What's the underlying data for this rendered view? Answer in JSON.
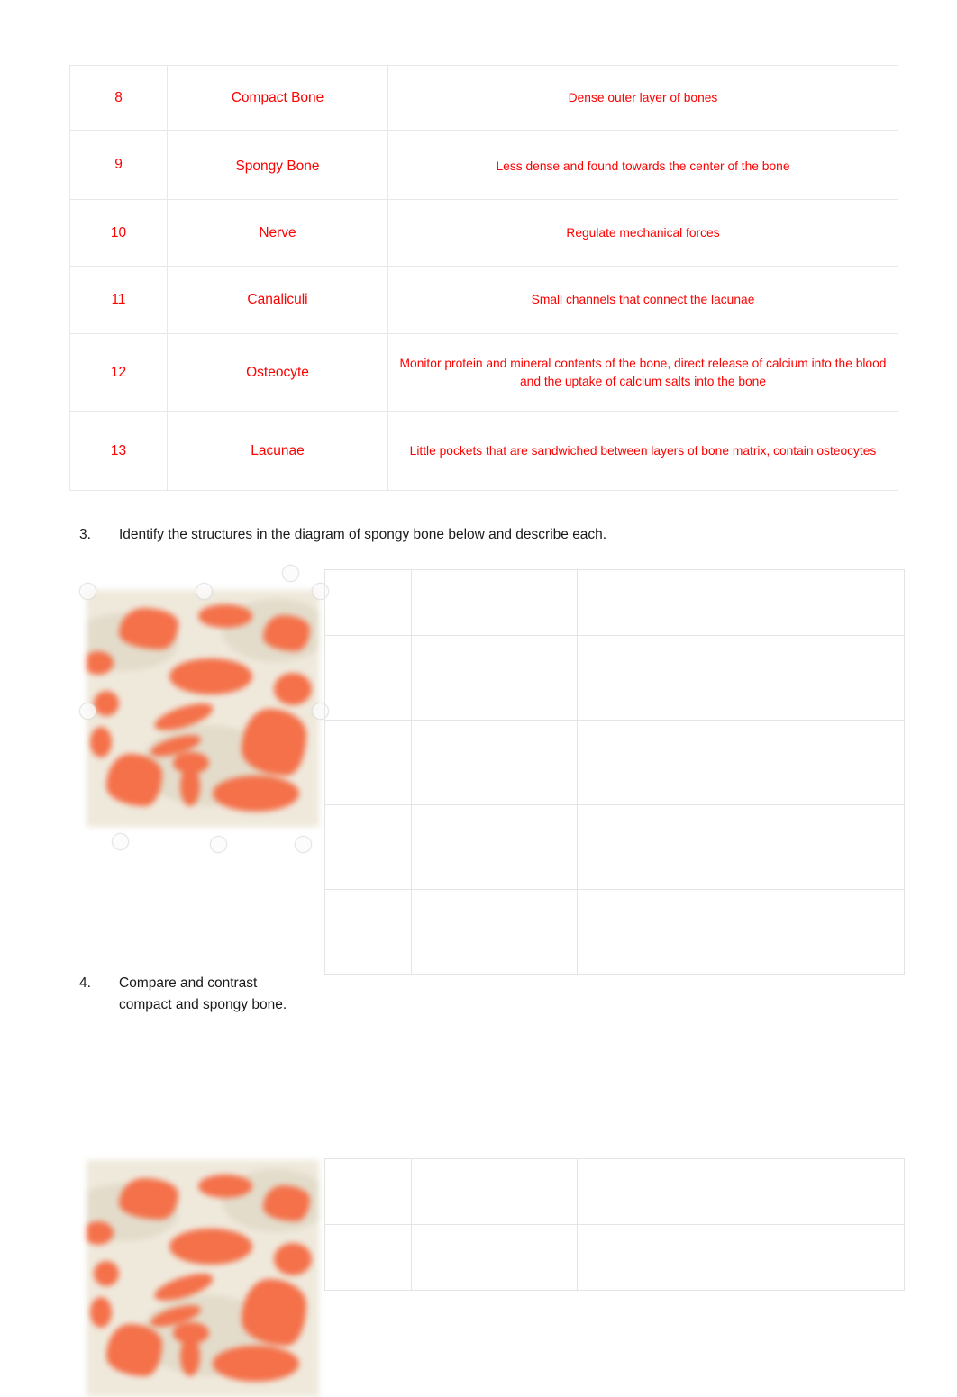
{
  "document": {
    "page_background": "#ffffff",
    "answer_text_color": "#ff0000",
    "body_text_color": "#1a1a1a"
  },
  "terms_table": {
    "rows": [
      {
        "number": "8",
        "term": "Compact Bone",
        "description": "Dense outer layer of bones"
      },
      {
        "number": "9",
        "term": "Spongy Bone",
        "description": "Less dense and found towards the center of the bone"
      },
      {
        "number": "10",
        "term": "Nerve",
        "description": "Regulate mechanical forces"
      },
      {
        "number": "11",
        "term": "Canaliculi",
        "description": "Small channels that connect the lacunae"
      },
      {
        "number": "12",
        "term": "Osteocyte",
        "description": "Monitor protein and mineral contents of the bone, direct release of calcium into the blood and the uptake of calcium salts into the bone"
      },
      {
        "number": "13",
        "term": "Lacunae",
        "description": "Little pockets that are sandwiched between layers of bone matrix, contain osteocytes"
      }
    ]
  },
  "questions": [
    {
      "number": "3.",
      "text": "Identify the structures in the diagram of spongy bone below and describe each."
    },
    {
      "number": "4.",
      "text": "Compare and contrast compact and spongy bone."
    }
  ],
  "figures": [
    {
      "name": "spongy-bone-micrograph",
      "caption": "",
      "matrix_color": "#efe9dc",
      "trabecula_color": "#f4714a",
      "selected": true
    },
    {
      "name": "spongy-bone-micrograph",
      "caption": "",
      "matrix_color": "#efe9dc",
      "trabecula_color": "#f4714a",
      "selected": false
    }
  ],
  "answer_tables": [
    {
      "name": "structures-answer-table",
      "columns": 3,
      "rows": 5,
      "cells": [
        [
          "",
          "",
          ""
        ],
        [
          "",
          "",
          ""
        ],
        [
          "",
          "",
          ""
        ],
        [
          "",
          "",
          ""
        ],
        [
          "",
          "",
          ""
        ]
      ]
    },
    {
      "name": "compare-contrast-answer-table",
      "columns": 3,
      "rows": 2,
      "cells": [
        [
          "",
          "",
          ""
        ],
        [
          "",
          "",
          ""
        ]
      ]
    }
  ]
}
